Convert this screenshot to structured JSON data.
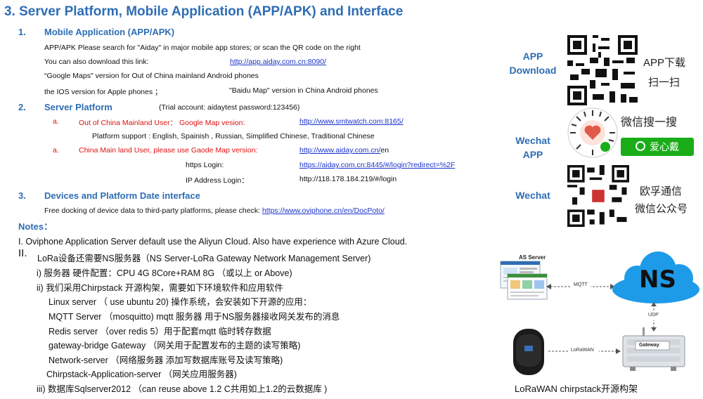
{
  "title": "3. Server Platform, Mobile Application (APP/APK) and Interface",
  "sections": {
    "s1": {
      "num": "1.",
      "heading": "Mobile Application (APP/APK)",
      "line1": "APP/APK Please search for \"Aiday\" in major mobile app stores; or scan the QR code on the right",
      "line2_label": "You can also download this link:",
      "line2_link": "http://app.aiday.com.cn:8090/",
      "line3": "“Google Maps\" version for Out of China mainland Android phones",
      "line4_left": "the IOS version for Apple phones ；",
      "line4_right": "\"Baidu Map\" version in China Android phones"
    },
    "s2": {
      "num": "2.",
      "heading": "Server Platform",
      "account": "(Trial account:   aidaytest           password:123456)",
      "a1_mark": "a.",
      "a1_label": "Out of China Mainland User：  Google Map vesion:",
      "a1_link": "http://www.smtwatch.com:8165/",
      "platform_support": "Platform support : English, Spainish , Russian, Simplified Chinese, Traditional Chinese",
      "a2_mark": "a.",
      "a2_label": "China Main land User, please use Gaode Map version:",
      "a2_link": "http://www.aiday.com.cn/",
      "a2_suffix": "en",
      "https_label": "https Login:",
      "https_link": "https://aiday.com.cn:8445/#/login?redirect=%2F",
      "ip_label": "IP Address Login：",
      "ip_value": "http://118.178.184.219/#/login"
    },
    "s3": {
      "num": "3.",
      "heading": "Devices and Platform Date interface",
      "line1": "Free docking of device data to third-party platforms, please check: ",
      "link": "https://www.oviphone.cn/en/DocPoto/"
    }
  },
  "notes": {
    "heading": "Notes：",
    "n1": "I.  Oviphone Application Server default use the Aliyun Cloud. Also have experience with Azure Cloud.",
    "n2_mark": "II.",
    "n2": "LoRa设备还需要NS服务器（NS Server-LoRa Gateway Network Management Server)",
    "n2_i": "i)   服务器 硬件配置：CPU 4G 8Core+RAM 8G  （或以上 or Above)",
    "n2_ii": "ii)  我们采用Chirpstack 开源构架，需要如下环境软件和应用软件",
    "linux": "Linux server  （ use ubuntu 20)   操作系统，会安装如下开源的应用：",
    "mqtt": "MQTT Server  （mosquitto)   mqtt 服务器 用于NS服务器接收网关发布的消息",
    "redis": "Redis server  （over redis 5）用于配套mqtt 临时转存数据",
    "gateway": "gateway-bridge Gateway  （网关用于配置发布的主题的读写策略)",
    "network": "Network-server  （网络服务器 添加写数据库账号及读写策略)",
    "chirp": "Chirpstack-Application-server  （网关应用服务器)",
    "n2_iii": "iii) 数据库Sqlserver2012  （can reuse above 1.2 C共用如上1.2的云数据库 )"
  },
  "side": {
    "app_label_1": "APP",
    "app_label_2": "Download",
    "app_cn_1": "APP下载",
    "app_cn_2": "扫一扫",
    "wechat_app_1": "Wechat",
    "wechat_app_2": "APP",
    "mini_search": "微信搜一搜",
    "mini_btn": "爱心戴",
    "wechat_label": "Wechat",
    "wechat_cn_1": "欧孚通信",
    "wechat_cn_2": "微信公众号"
  },
  "diagram": {
    "as_server": "AS Server",
    "ns": "NS",
    "mqtt": "MQTT",
    "udp": "UDP",
    "lorawan": "LoRaWAN",
    "gateway": "Gateway",
    "caption": "LoRaWAN chirpstack开源构架",
    "colors": {
      "cloud": "#1e9be8",
      "accent": "#2e6db4"
    }
  }
}
